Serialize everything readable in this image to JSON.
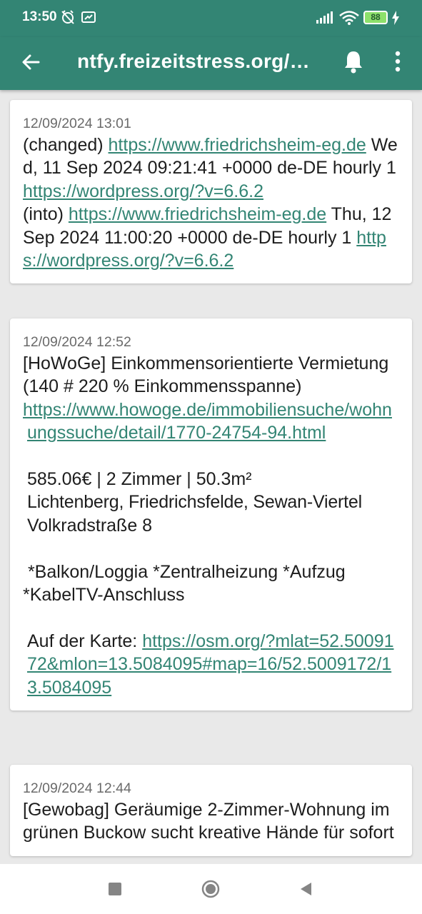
{
  "status_bar": {
    "time": "13:50",
    "battery": "88"
  },
  "app_bar": {
    "title": "ntfy.freizeitstress.org/…"
  },
  "notifications": [
    {
      "date": "12/09/2024 13:01",
      "lines": [
        {
          "t1": "(changed) ",
          "l1": "https://www.friedrichsheim-eg.de",
          "t2": " Wed, 11 Sep 2024 09:21:41 +0000 de-DE hourly 1 ",
          "l2": "https://wordpress.org/?v=6.6.2"
        },
        {
          "t1": "(into) ",
          "l1": "https://www.friedrichsheim-eg.de",
          "t2": " Thu, 12 Sep 2024 11:00:20 +0000 de-DE hourly 1 ",
          "l2": "https://wordpress.org/?v=6.6.2"
        }
      ]
    },
    {
      "date": "12/09/2024 12:52",
      "headline": "[HoWoGe]  Einkommensorientierte Vermietung (140 # 220 % Einkommensspanne)",
      "link": "https://www.howoge.de/immobiliensuche/wohnungssuche/detail/1770-24754-94.html",
      "price_line": "585.06€ | 2 Zimmer | 50.3m²",
      "district_line": "Lichtenberg, Friedrichsfelde, Sewan-Viertel",
      "street_line": "Volkradstraße 8",
      "features": " *Balkon/Loggia *Zentralheizung *Aufzug *KabelTV-Anschluss",
      "map_label": "Auf der Karte: ",
      "map_link": "https://osm.org/?mlat=52.5009172&mlon=13.5084095#map=16/52.5009172/13.5084095"
    },
    {
      "date": "12/09/2024 12:44",
      "headline": "[Gewobag]  Geräumige 2-Zimmer-Wohnung im grünen Buckow sucht kreative Hände für sofort"
    }
  ],
  "icons": {
    "back": "arrow-back-icon",
    "bell": "bell-icon",
    "more": "more-vert-icon",
    "colors": {
      "primary": "#338574",
      "link": "#338574"
    }
  }
}
